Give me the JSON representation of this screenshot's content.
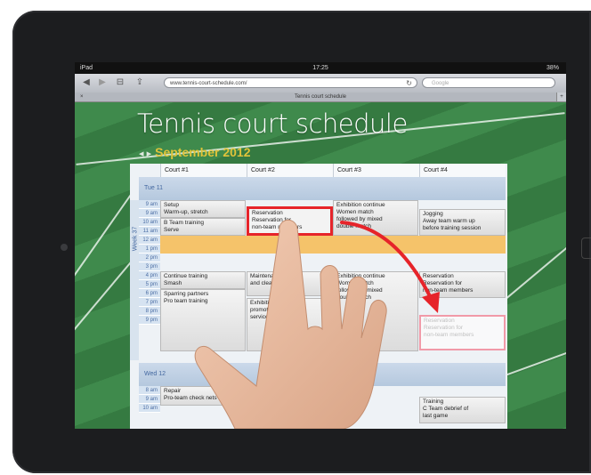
{
  "status_bar": {
    "device": "iPad",
    "time": "17:25",
    "battery": "38%"
  },
  "browser": {
    "url": "www.tennis-court-schedule.com/",
    "search_placeholder": "Google",
    "tab_title": "Tennis court schedule",
    "tab_close": "×",
    "new_tab": "+"
  },
  "page": {
    "title": "Tennis court schedule",
    "month": "September 2012"
  },
  "columns": [
    "Court #1",
    "Court #2",
    "Court #3",
    "Court #4"
  ],
  "week_label": "Week 37",
  "days": [
    {
      "label": "Tue 11",
      "times": [
        "9 am",
        "9 am",
        "10 am",
        "11 am",
        "12 am",
        "1 pm",
        "2 pm",
        "3 pm",
        "4 pm",
        "5 pm",
        "6 pm",
        "7 pm",
        "8 pm",
        "9 pm"
      ]
    },
    {
      "label": "Wed 12",
      "times": [
        "8 am",
        "9 am",
        "10 am"
      ]
    }
  ],
  "events": {
    "c1_morning": "Setup\nWarm-up, stretch",
    "c1_btraining": "B Team training\nServe",
    "c2_reservation": "Reservation\nReservation for\nnon-team members",
    "c3_exhibition": "Exhibition continue\nWomen match\nfollowed by mixed\ndouble match",
    "c4_jogging": "Jogging\nAway team warm up\nbefore training session",
    "c1_continue": "Continue training\nSmash",
    "c1_sparring": "Sparring partners\nPro team training",
    "c2_maintenance": "Maintenance: Water\nand cleaning",
    "c2_exhibition": "Exhibition match to\npromote the city court\nservices",
    "c3_exhibition2": "Exhibition continue\nWomen match\nfollowed by mixed\ndouble match",
    "c4_reservation": "Reservation\nReservation for\nnon-team members",
    "c4_ghost": "Reservation\nReservation for\nnon-team members",
    "c1_repair": "Repair\nPro-team check nets",
    "c4_training": "Training\nC Team debrief of\nlast game"
  }
}
